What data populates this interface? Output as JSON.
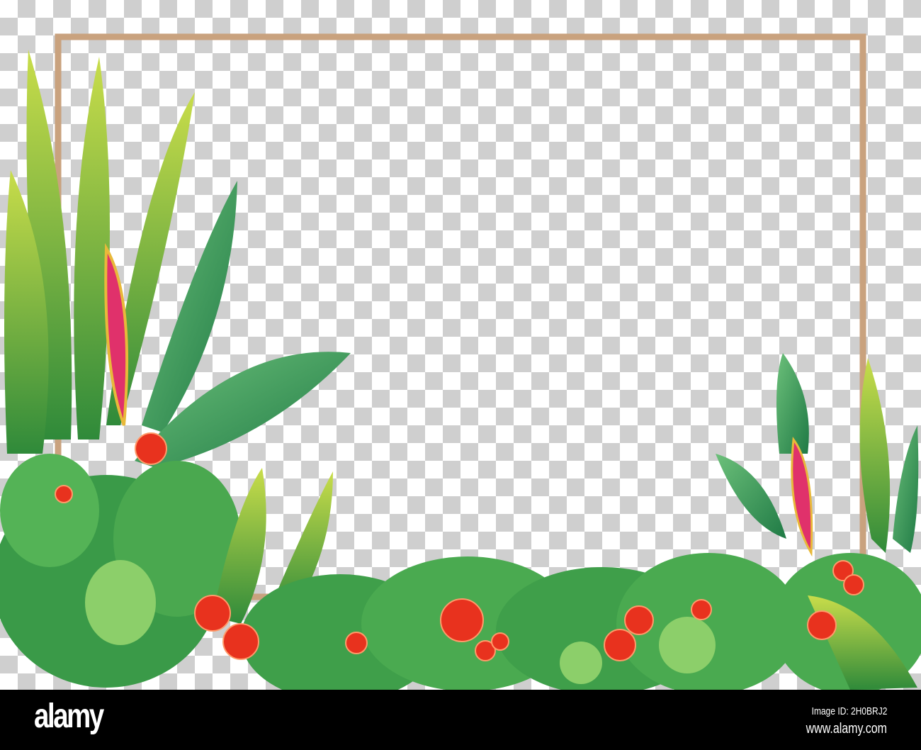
{
  "colors": {
    "frame": "#c9a27e",
    "leaf": "#3fa34d",
    "leaf_light": "#8cc63f",
    "flower": "#e8321e",
    "heliconia": "#e0316b"
  },
  "watermark": {
    "logo": "alamy",
    "image_id": "Image ID: 2H0BRJ2",
    "url": "www.alamy.com"
  }
}
